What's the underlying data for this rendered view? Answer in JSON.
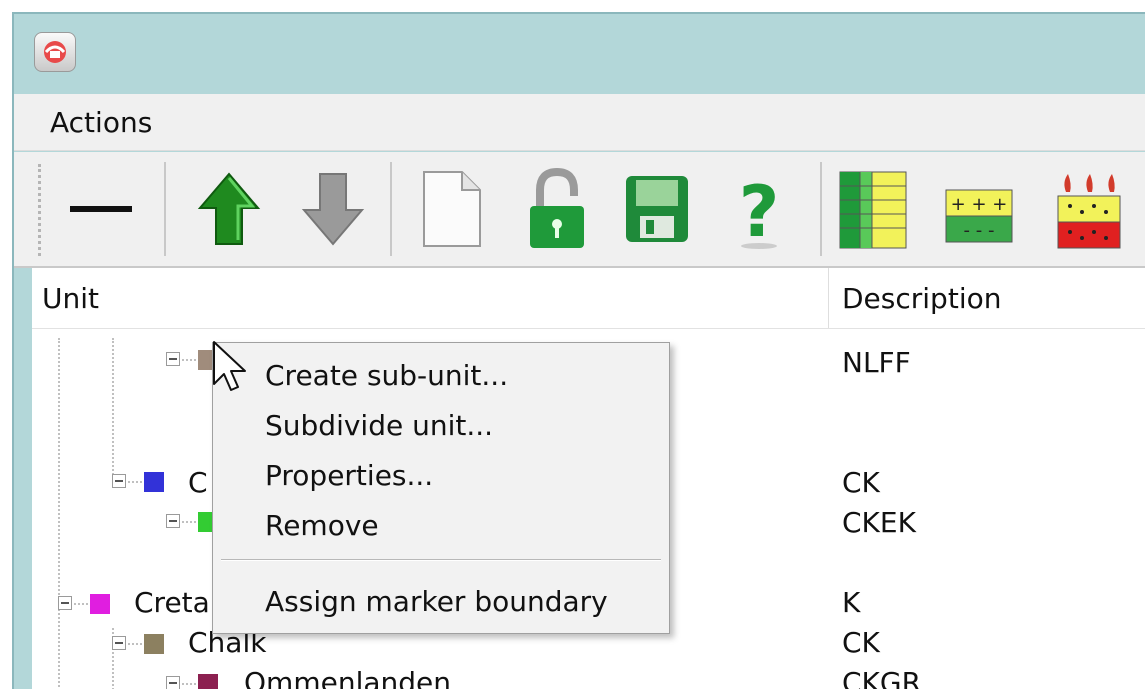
{
  "menu": {
    "actions_label": "Actions"
  },
  "toolbar": {
    "tools": [
      {
        "icon": "minus-icon"
      },
      {
        "icon": "arrow-up-icon"
      },
      {
        "icon": "arrow-down-icon"
      },
      {
        "icon": "new-document-icon"
      },
      {
        "icon": "unlock-icon"
      },
      {
        "icon": "save-icon"
      },
      {
        "icon": "help-icon"
      },
      {
        "icon": "table-grid-icon"
      },
      {
        "icon": "charge-layers-icon"
      },
      {
        "icon": "fire-layers-icon"
      }
    ]
  },
  "table": {
    "columns": {
      "unit": "Unit",
      "description": "Description"
    },
    "rows": [
      {
        "label": "",
        "description": "NLFF",
        "color": "#a08c7c"
      },
      {
        "label": "C",
        "description": "CK",
        "color": "#3232d8"
      },
      {
        "label": "",
        "description": "CKEK",
        "color": "#33cc33"
      },
      {
        "label": "Creta",
        "description": "K",
        "color": "#e01ee0"
      },
      {
        "label": "Chalk",
        "description": "CK",
        "color": "#8c8060"
      },
      {
        "label": "Ommenlanden",
        "description": "CKGR",
        "color": "#8c2050"
      }
    ]
  },
  "context_menu": {
    "items": [
      "Create sub-unit...",
      "Subdivide unit...",
      "Properties...",
      "Remove",
      "Assign marker boundary"
    ]
  },
  "colors": {
    "title_bar": "#b3d7d9",
    "selection": "#3399ff"
  }
}
